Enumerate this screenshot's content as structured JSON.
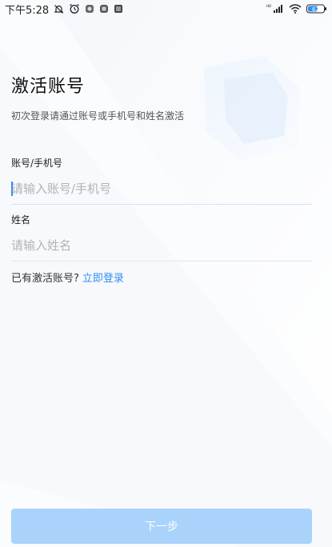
{
  "status_bar": {
    "time": "下午5:28",
    "network_label": "HD",
    "battery_level": "62"
  },
  "page": {
    "title": "激活账号",
    "subtitle": "初次登录请通过账号或手机号和姓名激活"
  },
  "account_field": {
    "label": "账号/手机号",
    "placeholder": "请输入账号/手机号",
    "value": ""
  },
  "name_field": {
    "label": "姓名",
    "placeholder": "请输入姓名",
    "value": ""
  },
  "login_prompt": {
    "text": "已有激活账号?",
    "link": "立即登录"
  },
  "next_button": {
    "label": "下一步"
  },
  "colors": {
    "accent": "#2f8ef0",
    "button_disabled": "#a9d3fb"
  }
}
